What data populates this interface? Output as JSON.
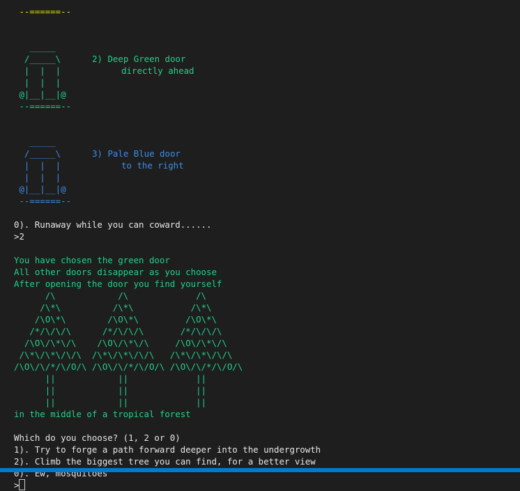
{
  "top_door": {
    "bottom_line": " --======--"
  },
  "door2": {
    "art": "   _____\n  /_____\\\n  |  |  |\n  |  |  |\n @|__|__|@\n --======--",
    "line1": "2) Deep Green door",
    "line2": "directly ahead"
  },
  "door3": {
    "art": "   _____\n  /_____\\\n  |  |  |\n  |  |  |\n @|__|__|@\n --======--",
    "line1": "3) Pale Blue door",
    "line2": "to the right"
  },
  "choice_zero": "0). Runaway while you can coward......",
  "input_1": ">2",
  "story": {
    "line1": "You have chosen the green door",
    "line2": "All other doors disappear as you choose",
    "line3": "After opening the door you find yourself",
    "forest_art": "      /\\            /\\             /\\\n     /\\*\\          /\\*\\           /\\*\\\n    /\\O\\*\\        /\\O\\*\\         /\\O\\*\\\n   /*/\\/\\/\\      /*/\\/\\/\\       /*/\\/\\/\\\n  /\\O\\/\\*\\/\\    /\\O\\/\\*\\/\\     /\\O\\/\\*\\/\\\n /\\*\\/\\*\\/\\/\\  /\\*\\/\\*\\/\\/\\   /\\*\\/\\*\\/\\/\\\n/\\O\\/\\/*/\\/O/\\ /\\O\\/\\/*/\\/O/\\ /\\O\\/\\/*/\\/O/\\\n      ||            ||             ||\n      ||            ||             ||\n      ||            ||             ||",
    "line4": "in the middle of a tropical forest"
  },
  "prompt": {
    "question": "Which do you choose? (1, 2 or 0)",
    "option1": "1). Try to forge a path forward deeper into the undergrowth",
    "option2": "2). Climb the biggest tree you can find, for a better view",
    "option0": "0). Ew, mosquitoes",
    "input_prefix": ">"
  },
  "colors": {
    "yellow": "#e5e510",
    "green": "#23d18b",
    "blue": "#3b8eea",
    "text": "#cccccc",
    "background": "#1e1e1e",
    "status_bar": "#007acc"
  }
}
